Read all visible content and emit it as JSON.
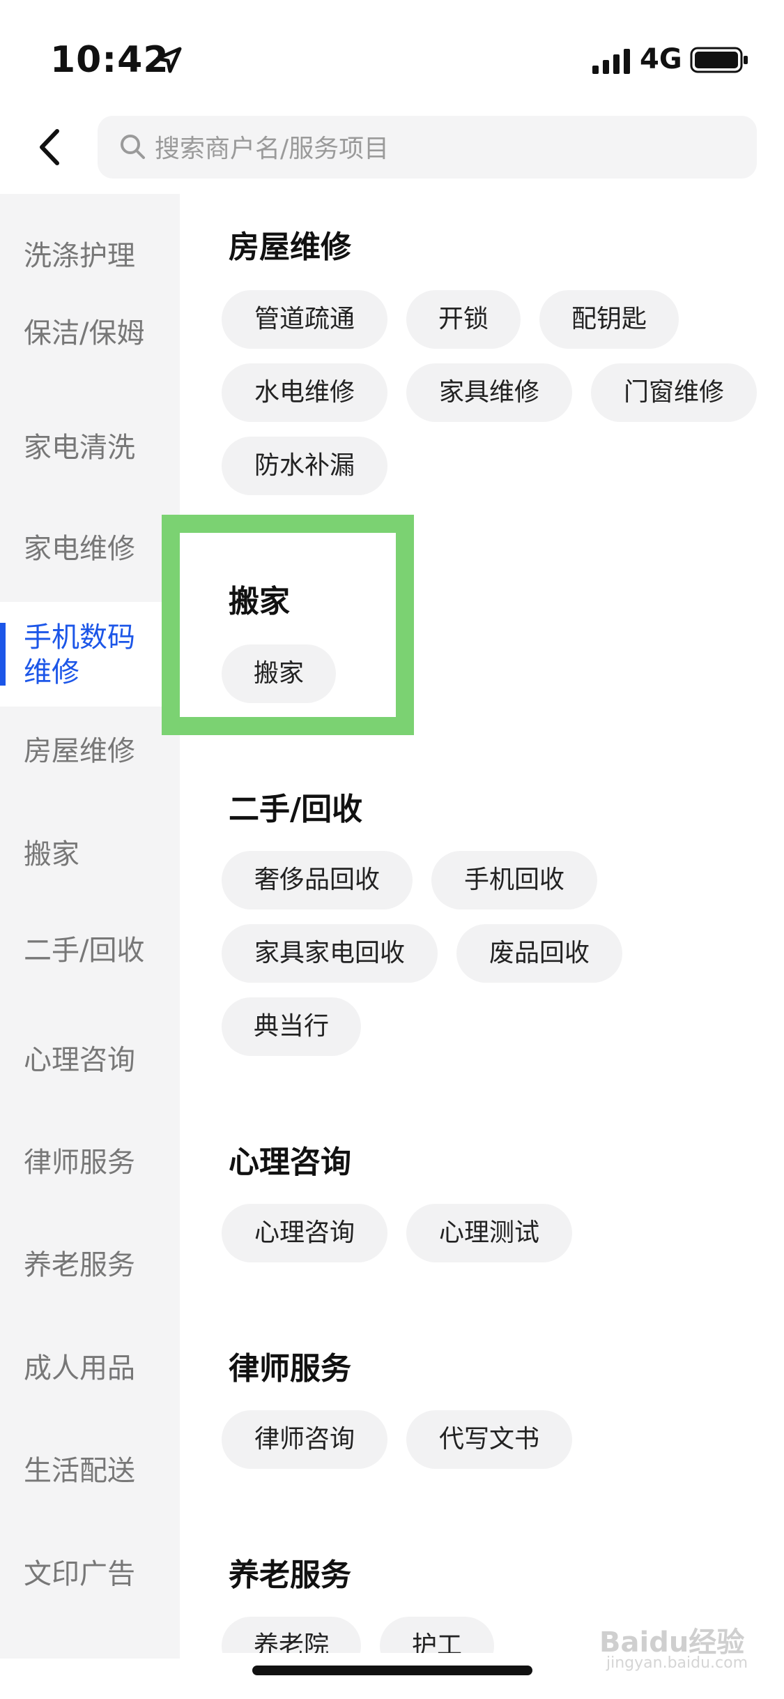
{
  "status_bar": {
    "time": "10:42",
    "network": "4G"
  },
  "search": {
    "placeholder": "搜索商户名/服务项目"
  },
  "sidebar": {
    "items": [
      {
        "label": "洗涤护理"
      },
      {
        "label": "保洁/保姆"
      },
      {
        "label": "家电清洗"
      },
      {
        "label": "家电维修"
      },
      {
        "label": "手机数码维修",
        "active": true
      },
      {
        "label": "房屋维修"
      },
      {
        "label": "搬家"
      },
      {
        "label": "二手/回收"
      },
      {
        "label": "心理咨询"
      },
      {
        "label": "律师服务"
      },
      {
        "label": "养老服务"
      },
      {
        "label": "成人用品"
      },
      {
        "label": "生活配送"
      },
      {
        "label": "文印广告"
      }
    ]
  },
  "sections": [
    {
      "title": "房屋维修",
      "chips": [
        "管道疏通",
        "开锁",
        "配钥匙",
        "水电维修",
        "家具维修",
        "门窗维修",
        "防水补漏"
      ]
    },
    {
      "title": "搬家",
      "chips": [
        "搬家"
      ]
    },
    {
      "title": "二手/回收",
      "chips": [
        "奢侈品回收",
        "手机回收",
        "家具家电回收",
        "废品回收",
        "典当行"
      ]
    },
    {
      "title": "心理咨询",
      "chips": [
        "心理咨询",
        "心理测试"
      ]
    },
    {
      "title": "律师服务",
      "chips": [
        "律师咨询",
        "代写文书"
      ]
    },
    {
      "title": "养老服务",
      "chips": [
        "养老院",
        "护工"
      ]
    }
  ],
  "watermark": {
    "text": "Baidu经验",
    "sub": "jingyan.baidu.com"
  },
  "colors": {
    "accent": "#1c56e8",
    "highlight": "#7bd272",
    "sidebar_bg": "#f4f4f5",
    "chip_bg": "#f2f2f3"
  }
}
